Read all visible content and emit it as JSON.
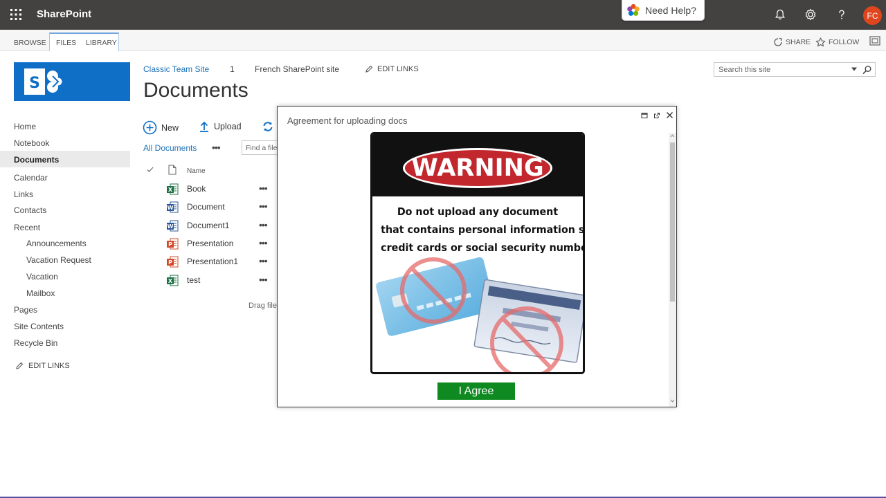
{
  "suite": {
    "brand": "SharePoint",
    "need_help": "Need Help?",
    "avatar_initials": "FC",
    "bar_color": "#444241",
    "avatar_color": "#e0461e"
  },
  "ribbon": {
    "tabs": [
      "BROWSE",
      "FILES",
      "LIBRARY"
    ],
    "actions": {
      "share": "SHARE",
      "follow": "FOLLOW"
    }
  },
  "header": {
    "top_links": [
      "Classic Team Site",
      "1",
      "French SharePoint site"
    ],
    "edit_links": "EDIT LINKS",
    "page_title": "Documents",
    "search_placeholder": "Search this site"
  },
  "leftnav": {
    "items": [
      {
        "label": "Home",
        "level": 0
      },
      {
        "label": "Notebook",
        "level": 0
      },
      {
        "label": "Documents",
        "level": 0,
        "selected": true
      },
      {
        "label": "Calendar",
        "level": 0
      },
      {
        "label": "Links",
        "level": 0
      },
      {
        "label": "Contacts",
        "level": 0
      },
      {
        "label": "Recent",
        "level": 0
      },
      {
        "label": "Announcements",
        "level": 1
      },
      {
        "label": "Vacation Request",
        "level": 1
      },
      {
        "label": "Vacation",
        "level": 1
      },
      {
        "label": "Mailbox",
        "level": 1
      },
      {
        "label": "Pages",
        "level": 0
      },
      {
        "label": "Site Contents",
        "level": 0
      },
      {
        "label": "Recycle Bin",
        "level": 0
      }
    ],
    "edit_links": "EDIT LINKS"
  },
  "library": {
    "commands": {
      "new": "New",
      "upload": "Upload"
    },
    "view_name": "All Documents",
    "find_placeholder": "Find a file",
    "column_name": "Name",
    "files": [
      {
        "name": "Book",
        "type": "excel",
        "letter": "X"
      },
      {
        "name": "Document",
        "type": "word",
        "letter": "W"
      },
      {
        "name": "Document1",
        "type": "word",
        "letter": "W"
      },
      {
        "name": "Presentation",
        "type": "powerpoint",
        "letter": "P"
      },
      {
        "name": "Presentation1",
        "type": "powerpoint",
        "letter": "P"
      },
      {
        "name": "test",
        "type": "excel",
        "letter": "X"
      }
    ],
    "drag_text": "Drag file"
  },
  "dialog": {
    "title": "Agreement for uploading docs",
    "poster": {
      "heading": "WARNING",
      "message_lines": [
        "Do not upload any document",
        "that contains personal information such as",
        "credit cards or social security numbers!"
      ]
    },
    "agree_label": "I Agree",
    "agree_color": "#0f8a20"
  }
}
